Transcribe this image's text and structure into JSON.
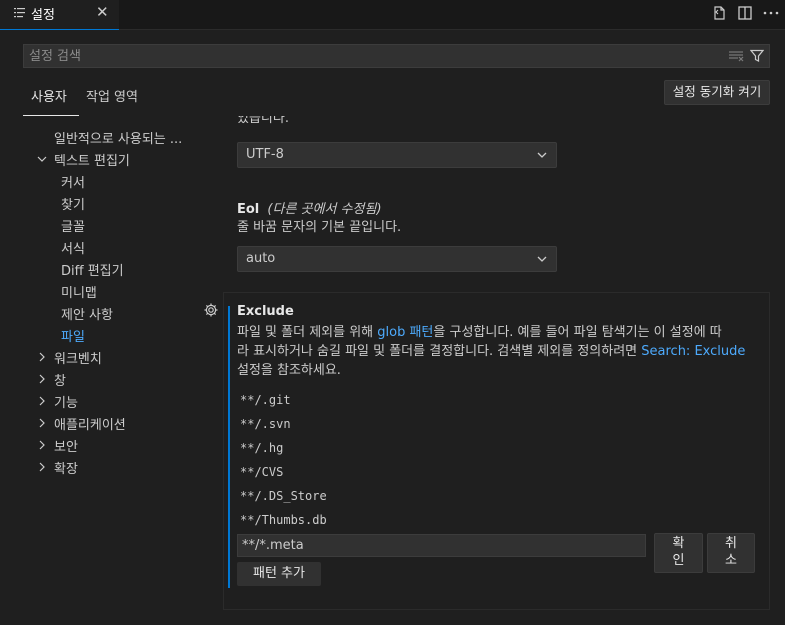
{
  "tab": {
    "title": "설정",
    "close_glyph": "✕"
  },
  "tab_actions": [
    "open-settings-json-icon",
    "split-editor-icon",
    "more-actions-icon"
  ],
  "search": {
    "placeholder": "설정 검색"
  },
  "scope": {
    "user": "사용자",
    "workspace": "작업 영역"
  },
  "sync_button": "설정 동기화 켜기",
  "toc": {
    "commonly_used": "일반적으로 사용되는 ...",
    "text_editor": "텍스트 편집기",
    "text_editor_children": [
      "커서",
      "찾기",
      "글꼴",
      "서식",
      "Diff 편집기",
      "미니맵",
      "제안 사항",
      "파일"
    ],
    "collapsed": [
      "워크벤치",
      "창",
      "기능",
      "애플리케이션",
      "보안",
      "확장"
    ],
    "active_child": "파일"
  },
  "settings": {
    "partial_text": "있습니다.",
    "encoding_value": "UTF-8",
    "eol": {
      "name": "Eol",
      "modified": "(다른 곳에서 수정됨)",
      "description": "줄 바꿈 문자의 기본 끝입니다.",
      "value": "auto"
    },
    "exclude": {
      "name": "Exclude",
      "desc_1": "파일 및 폴더 제외를 위해 ",
      "desc_link_1": "glob 패턴",
      "desc_2": "을 구성합니다. 예를 들어 파일 탐색기는 이 설정에 따",
      "desc_3": "라 표시하거나 숨길 파일 및 폴더를 결정합니다. 검색별 제외를 정의하려면 ",
      "desc_link_2": "Search: Exclude",
      "desc_4": "설정을 참조하세요.",
      "patterns": [
        "**/.git",
        "**/.svn",
        "**/.hg",
        "**/CVS",
        "**/.DS_Store",
        "**/Thumbs.db"
      ],
      "edit_value": "**/*.meta",
      "ok_button_line1": "확",
      "ok_button_line2": "인",
      "cancel_button_line1": "취",
      "cancel_button_line2": "소",
      "add_pattern_button": "패턴 추가"
    }
  },
  "colors": {
    "accent": "#0078d4",
    "link": "#4daafc",
    "background": "#1f1f1f"
  }
}
